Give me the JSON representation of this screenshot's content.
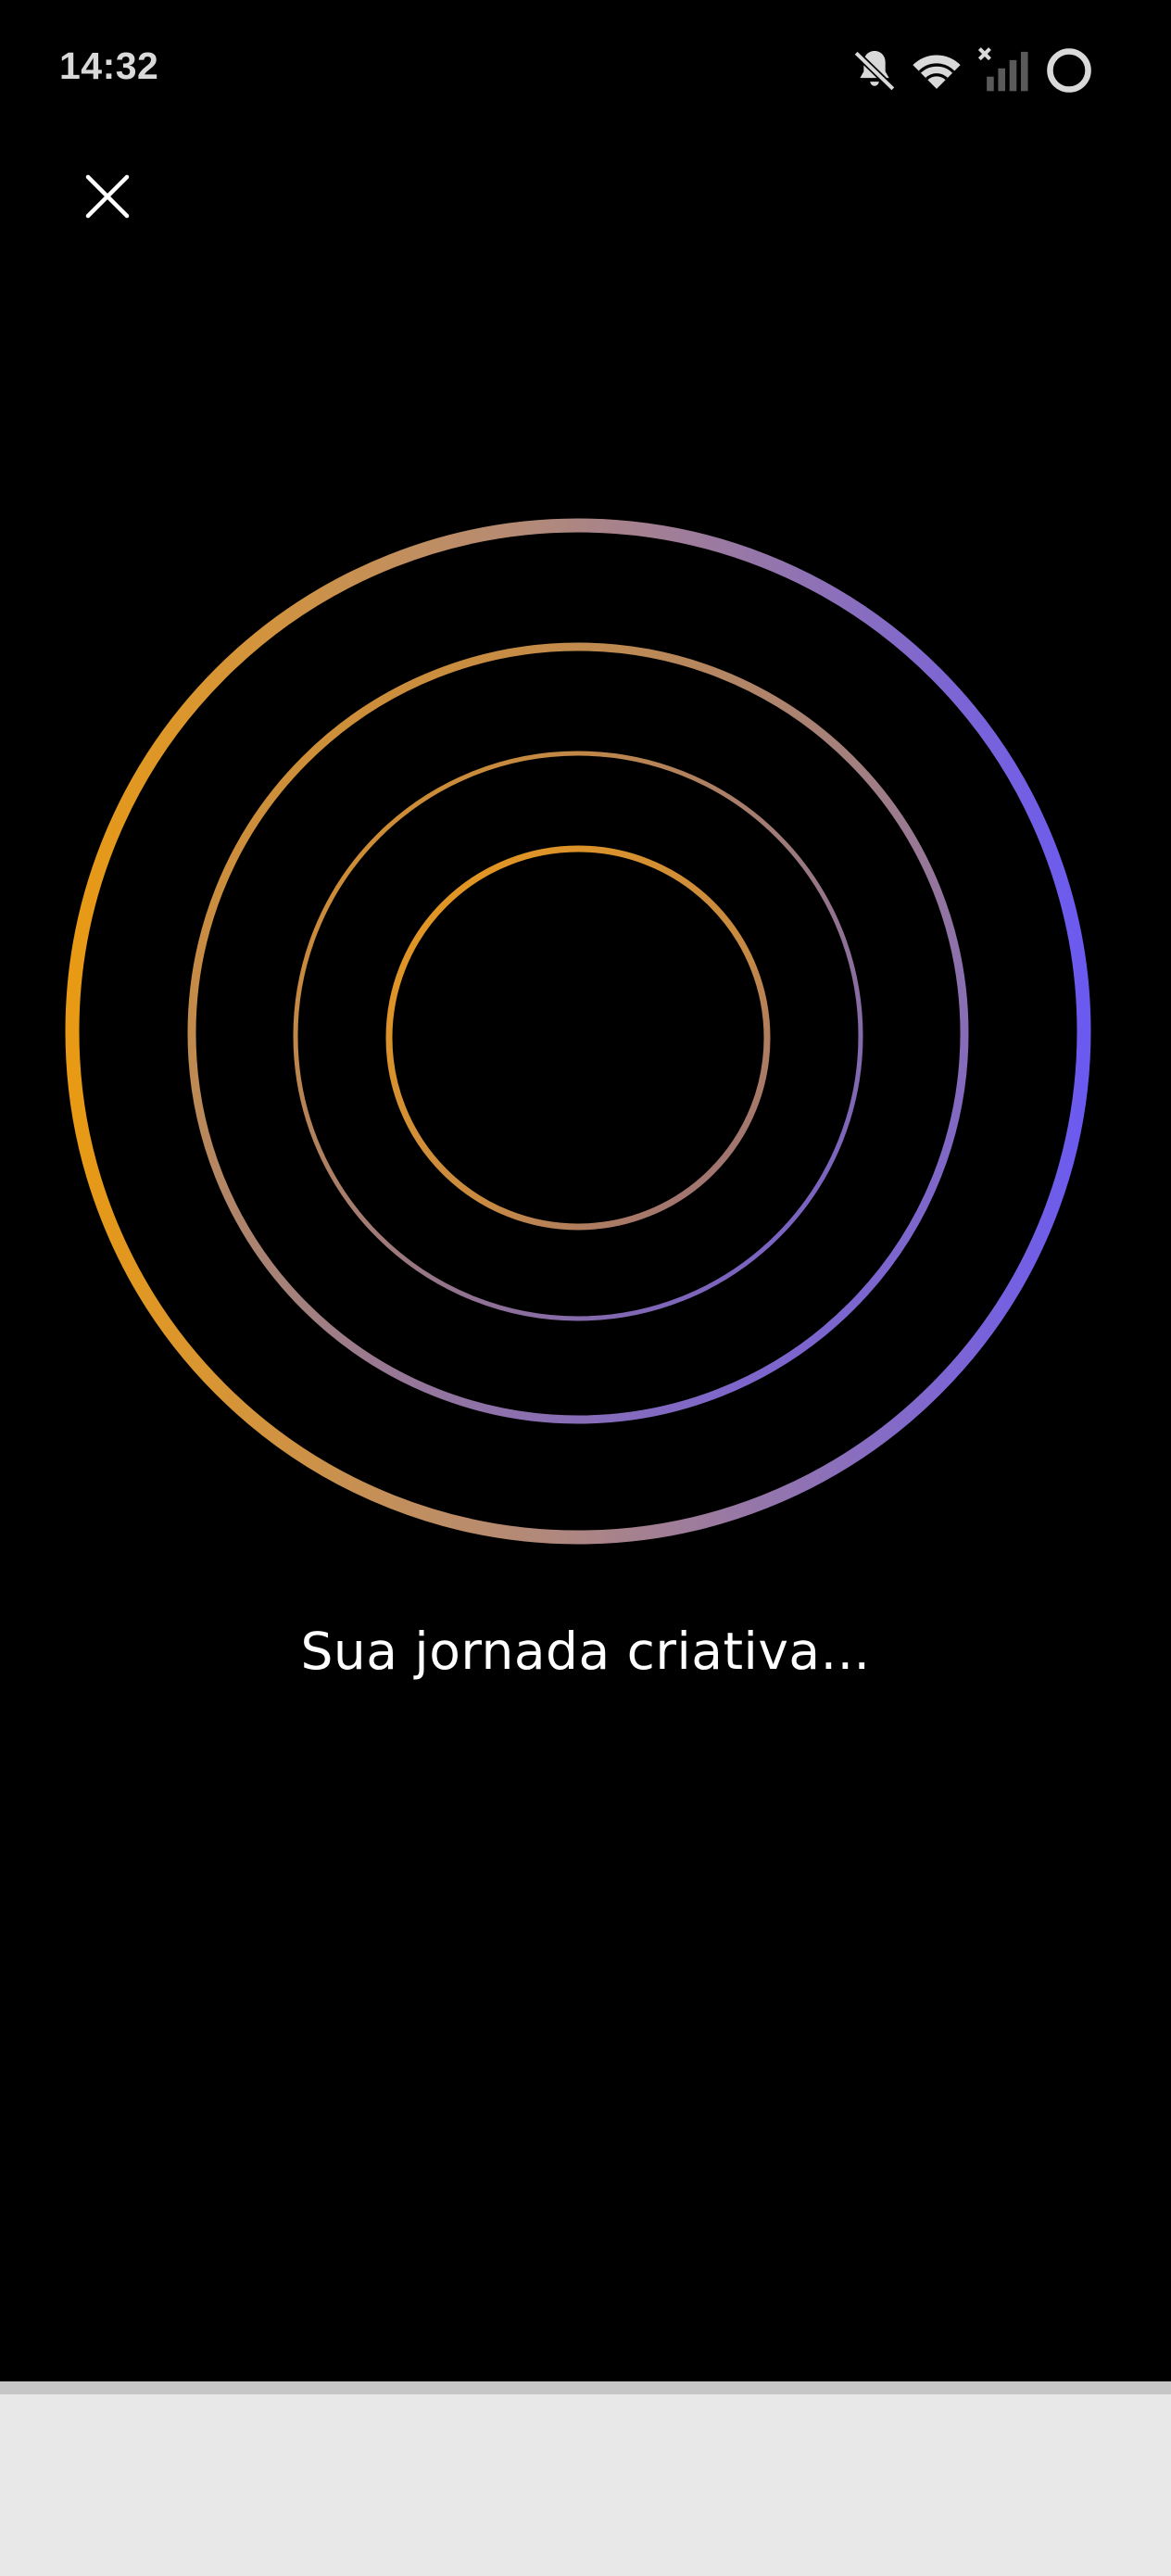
{
  "status_bar": {
    "time": "14:32",
    "icons": [
      "bell-muted-icon",
      "wifi-icon",
      "signal-off-icon",
      "battery-circle-icon"
    ]
  },
  "close_button": {
    "icon": "close-icon"
  },
  "loading": {
    "text": "Sua jornada criativa..."
  },
  "colors": {
    "background": "#000000",
    "ring_orange": "#e89a14",
    "ring_purple": "#6b5af0",
    "text": "#ffffff",
    "bottom_area": "#e8e8e8"
  }
}
